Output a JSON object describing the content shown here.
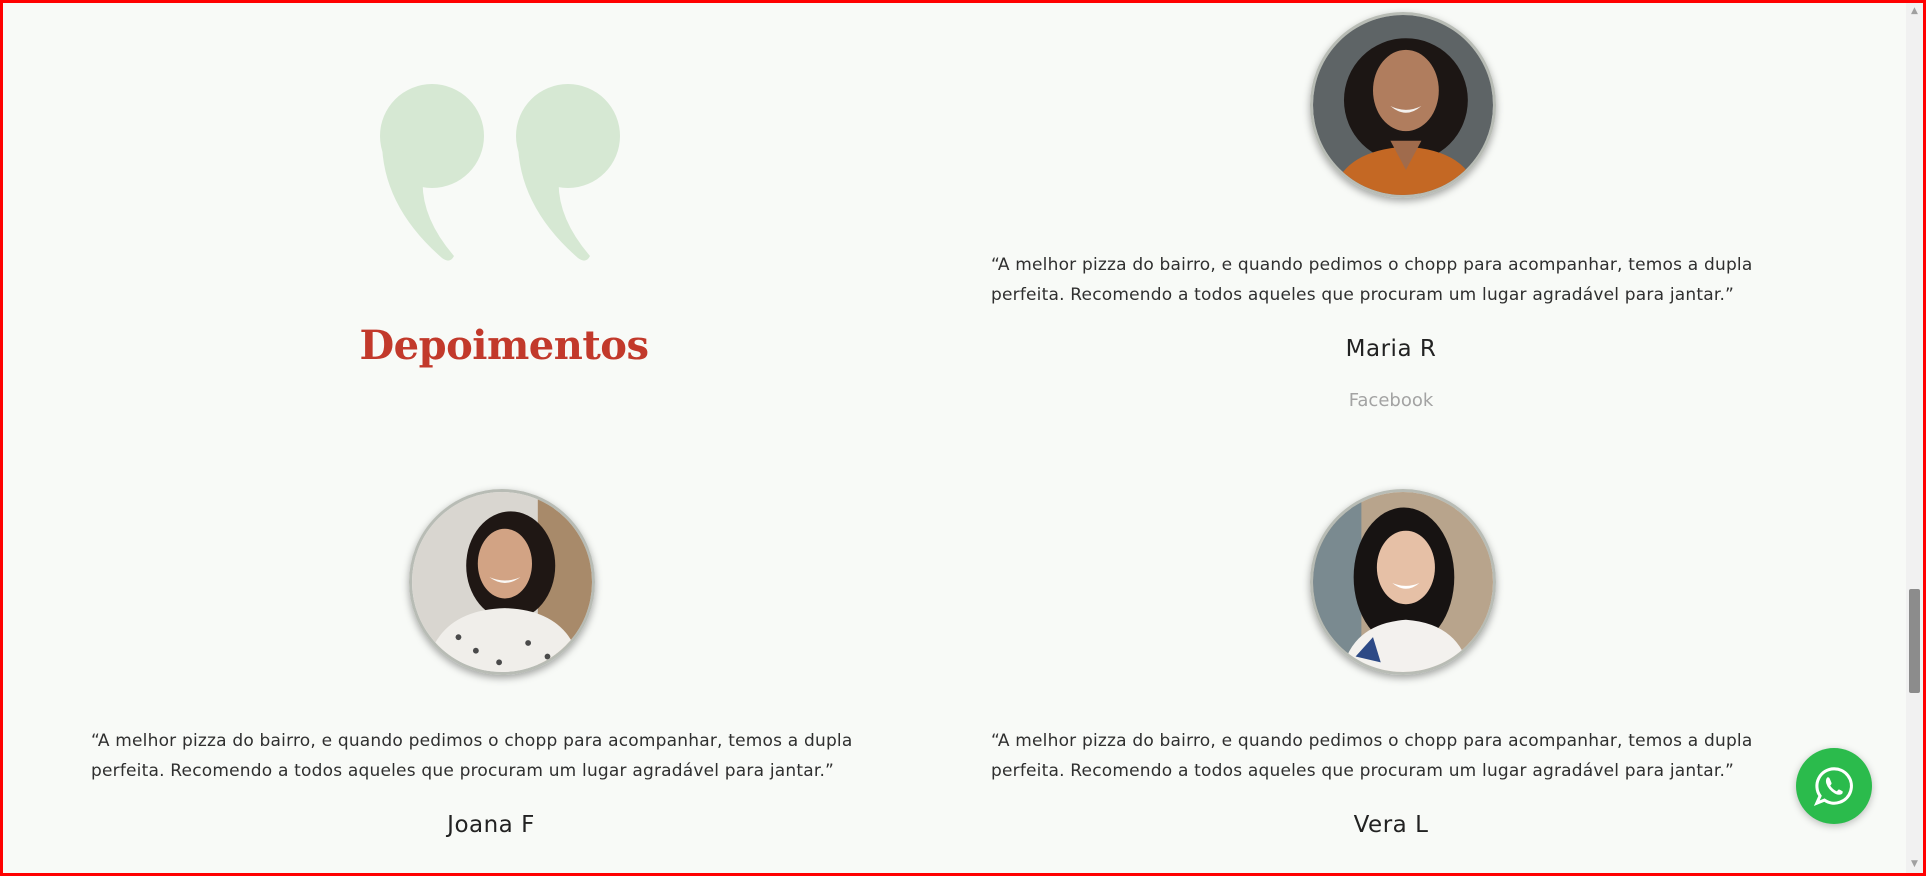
{
  "section": {
    "title": "Depoimentos"
  },
  "testimonials": [
    {
      "quote": "“A melhor pizza do bairro, e quando pedimos o chopp para acompanhar, temos a dupla perfeita. Recomendo a todos aqueles que procuram um lugar agradável para jantar.”",
      "author": "Maria R",
      "source": "Facebook"
    },
    {
      "quote": "“A melhor pizza do bairro, e quando pedimos o chopp para acompanhar, temos a dupla perfeita. Recomendo a todos aqueles que procuram um lugar agradável para jantar.”",
      "author": "Joana F"
    },
    {
      "quote": "“A melhor pizza do bairro, e quando pedimos o chopp para acompanhar, temos a dupla perfeita. Recomendo a todos aqueles que procuram um lugar agradável para jantar.”",
      "author": "Vera L"
    }
  ],
  "icons": {
    "quote": "quote-icon",
    "whatsapp": "whatsapp-icon"
  },
  "colors": {
    "background": "#f8faf7",
    "title": "#c2392b",
    "quote_mark": "#d6e8d3",
    "whatsapp": "#2bbb4c",
    "source": "#a3a3a3",
    "frame": "#ff0000"
  }
}
